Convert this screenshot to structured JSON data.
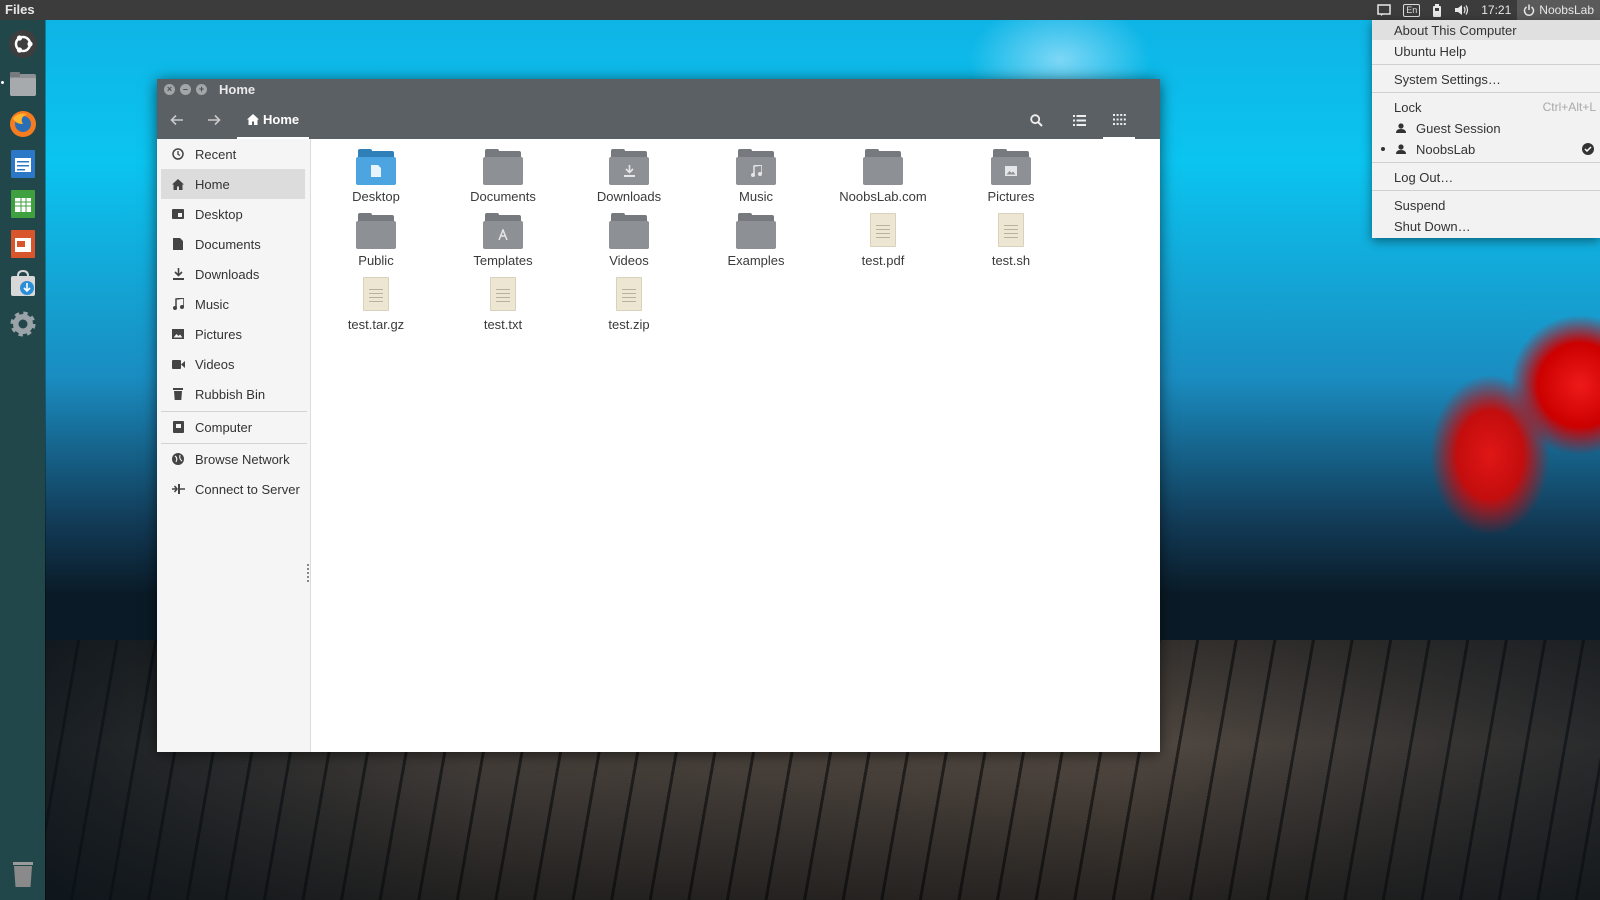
{
  "top_panel": {
    "app_name": "Files",
    "indicators": {
      "keyboard_layout": "En",
      "time": "17:21",
      "user": "NoobsLab"
    }
  },
  "launcher": {
    "items": [
      "ubuntu-dash",
      "files",
      "firefox",
      "libreoffice-writer",
      "libreoffice-calc",
      "libreoffice-impress",
      "software-center",
      "system-settings",
      "trash"
    ]
  },
  "window": {
    "title": "Home",
    "path_button": "Home",
    "sidebar": {
      "items": [
        {
          "label": "Recent",
          "icon": "clock-icon"
        },
        {
          "label": "Home",
          "icon": "home-icon",
          "selected": true
        },
        {
          "label": "Desktop",
          "icon": "desktop-icon"
        },
        {
          "label": "Documents",
          "icon": "document-icon"
        },
        {
          "label": "Downloads",
          "icon": "download-icon"
        },
        {
          "label": "Music",
          "icon": "music-icon"
        },
        {
          "label": "Pictures",
          "icon": "pictures-icon"
        },
        {
          "label": "Videos",
          "icon": "video-icon"
        },
        {
          "label": "Rubbish Bin",
          "icon": "trash-icon"
        }
      ],
      "devices": [
        {
          "label": "Computer",
          "icon": "computer-icon"
        }
      ],
      "network": [
        {
          "label": "Browse Network",
          "icon": "network-icon"
        },
        {
          "label": "Connect to Server",
          "icon": "server-icon"
        }
      ]
    },
    "files": [
      {
        "name": "Desktop",
        "type": "folder-desktop"
      },
      {
        "name": "Documents",
        "type": "folder"
      },
      {
        "name": "Downloads",
        "type": "folder-download"
      },
      {
        "name": "Music",
        "type": "folder-music"
      },
      {
        "name": "NoobsLab.com",
        "type": "folder"
      },
      {
        "name": "Pictures",
        "type": "folder-pictures"
      },
      {
        "name": "Public",
        "type": "folder"
      },
      {
        "name": "Templates",
        "type": "folder-templates"
      },
      {
        "name": "Videos",
        "type": "folder"
      },
      {
        "name": "Examples",
        "type": "folder"
      },
      {
        "name": "test.pdf",
        "type": "file"
      },
      {
        "name": "test.sh",
        "type": "file"
      },
      {
        "name": "test.tar.gz",
        "type": "file"
      },
      {
        "name": "test.txt",
        "type": "file"
      },
      {
        "name": "test.zip",
        "type": "file"
      }
    ]
  },
  "session_menu": {
    "about": "About This Computer",
    "help": "Ubuntu Help",
    "settings": "System Settings…",
    "lock": "Lock",
    "lock_shortcut": "Ctrl+Alt+L",
    "guest": "Guest Session",
    "current_user": "NoobsLab",
    "logout": "Log Out…",
    "suspend": "Suspend",
    "shutdown": "Shut Down…"
  },
  "colors": {
    "launcher_bg": "#22474a",
    "headerbar_bg": "#5b6065",
    "folder_grey": "#8d9094",
    "folder_blue": "#4ca4e0"
  }
}
